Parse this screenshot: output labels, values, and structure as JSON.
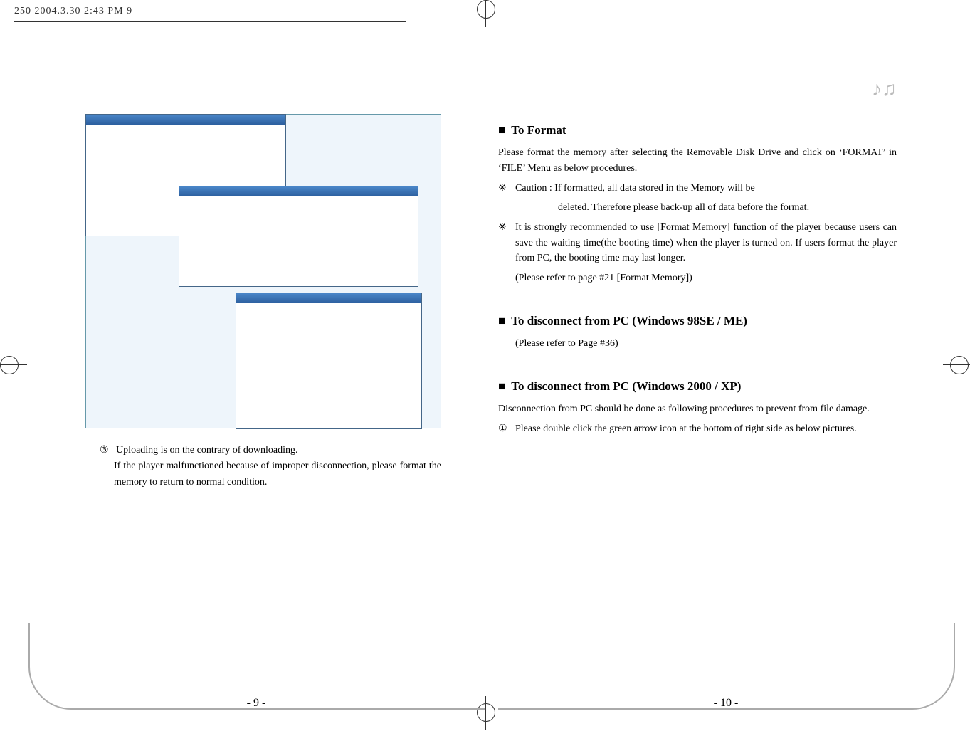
{
  "header": {
    "text": "250             2004.3.30 2:43 PM          9"
  },
  "left_page": {
    "para_marker": "③",
    "para1": "Uploading is on the contrary of downloading.",
    "para2": "If the player malfunctioned because of improper disconnection, please format the memory to return to normal condition.",
    "page_num": "-   9   -"
  },
  "right_page": {
    "sec1_title": "To Format",
    "sec1_p1": "Please format the memory after selecting the Removable Disk Drive and click on ‘FORMAT’ in ‘FILE’ Menu as below procedures.",
    "note_mark": "※",
    "sec1_note1a": "Caution : If formatted, all data stored in the Memory will be",
    "sec1_note1b": "deleted. Therefore please back-up all of data before the format.",
    "sec1_note2": "It is strongly recommended to use [Format Memory] function of the player because users can save the waiting time(the booting time) when the player is turned on. If users format the player from PC, the booting time may last longer.",
    "sec1_note2_ref": "(Please refer to page #21 [Format Memory])",
    "sec2_title": "To disconnect from PC (Windows 98SE / ME)",
    "sec2_ref": "(Please refer to Page #36)",
    "sec3_title": "To disconnect from PC (Windows 2000 / XP)",
    "sec3_p1": "Disconnection from PC should be done as following procedures to prevent from file damage.",
    "sec3_item_mark": "①",
    "sec3_item1": "Please double click the green arrow icon at the bottom of right side as below pictures.",
    "page_num": "-   10   -"
  },
  "icons": {
    "music": "♪♫"
  }
}
